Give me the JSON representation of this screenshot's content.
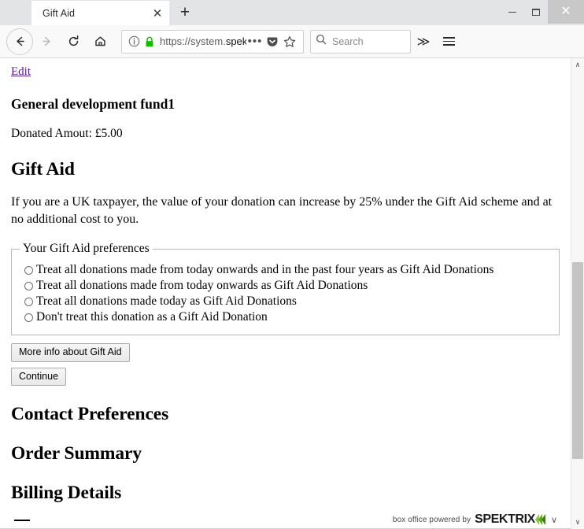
{
  "window": {
    "controls": {
      "minimize_label": "Minimize",
      "maximize_label": "Maximize",
      "close_label": "Close"
    }
  },
  "tabbar": {
    "active_tab": "Gift Aid",
    "close_glyph": "✕",
    "newtab_glyph": "+"
  },
  "toolbar": {
    "back_label": "Back",
    "forward_label": "Forward",
    "reload_label": "Reload",
    "home_label": "Home",
    "url_prefix": "https://system.",
    "url_domain": "spektrix.com",
    "page_actions_glyph": "•••",
    "pocket_label": "Save to Pocket",
    "bookmark_label": "Bookmark this page",
    "search_placeholder": "Search",
    "overflow_glyph": "≫",
    "menu_label": "Open menu"
  },
  "page": {
    "edit_link": "Edit",
    "fund_title": "General development fund1",
    "donated_amount": "Donated Amout: £5.00",
    "gift_aid_heading": "Gift Aid",
    "gift_aid_paragraph": "If you are a UK taxpayer, the value of your donation can increase by 25% under the Gift Aid scheme and at no additional cost to you.",
    "fieldset_legend": "Your Gift Aid preferences",
    "options": [
      {
        "label": "Treat all donations made from today onwards and in the past four years as Gift Aid Donations",
        "selected": false
      },
      {
        "label": "Treat all donations made from today onwards as Gift Aid Donations",
        "selected": false
      },
      {
        "label": "Treat all donations made today as Gift Aid Donations",
        "selected": false
      },
      {
        "label": "Don't treat this donation as a Gift Aid Donation",
        "selected": false
      }
    ],
    "more_info_button": "More info about Gift Aid",
    "continue_button": "Continue",
    "section_contact": "Contact Preferences",
    "section_order": "Order Summary",
    "section_billing": "Billing Details"
  },
  "footer": {
    "powered_text": "box office powered by",
    "brand_name": "SPEKTRIX",
    "caret_glyph": "∨"
  },
  "scrollbar": {
    "up_glyph": "∧",
    "down_glyph": "∨"
  },
  "colors": {
    "accent_green_light": "#8dc63f",
    "accent_green_mid": "#5fa52a",
    "accent_green_dark": "#3d7d16",
    "visited_link": "#551a8b",
    "lock_green": "#12bc00"
  }
}
